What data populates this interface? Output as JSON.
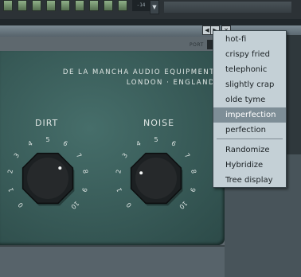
{
  "toolbar": {
    "zoom_text": "-14",
    "zoom_arrow": "▼"
  },
  "window": {
    "nav_prev": "◀",
    "nav_next": "▶",
    "close": "✕",
    "port_label": "PORT"
  },
  "plugin": {
    "brand_line1": "DE LA MANCHA AUDIO EQUIPMENT",
    "brand_line2": "LONDON · ENGLAND",
    "knobs": [
      {
        "label": "DIRT",
        "ticks": [
          "0",
          "1",
          "2",
          "3",
          "4",
          "5",
          "6",
          "7",
          "8",
          "9",
          "10"
        ]
      },
      {
        "label": "NOISE",
        "ticks": [
          "0",
          "1",
          "2",
          "3",
          "4",
          "5",
          "6",
          "7",
          "8",
          "9",
          "10"
        ]
      }
    ]
  },
  "menu": {
    "items": [
      {
        "label": "hot-fi",
        "selected": false
      },
      {
        "label": "crispy fried",
        "selected": false
      },
      {
        "label": "telephonic",
        "selected": false
      },
      {
        "label": "slightly crap",
        "selected": false
      },
      {
        "label": "olde tyme",
        "selected": false
      },
      {
        "label": "imperfection",
        "selected": true
      },
      {
        "label": "perfection",
        "selected": false
      }
    ],
    "actions": [
      {
        "label": "Randomize"
      },
      {
        "label": "Hybridize"
      },
      {
        "label": "Tree display"
      }
    ]
  },
  "colors": {
    "panel": "#3b5c5a",
    "menu_bg": "#c4d0d6",
    "menu_selected": "#7e8e97"
  }
}
